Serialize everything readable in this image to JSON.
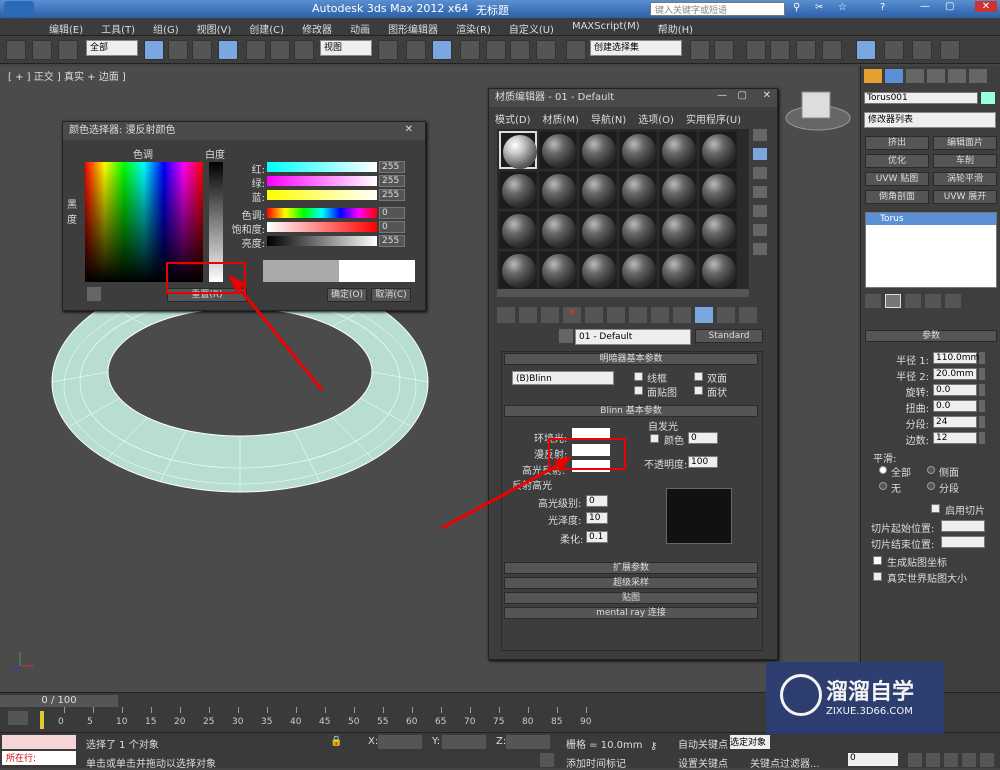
{
  "titlebar": {
    "app_title": "Autodesk 3ds Max  2012 x64",
    "doc_title": "无标题",
    "search_placeholder": "键入关键字或短语"
  },
  "menu": [
    "编辑(E)",
    "工具(T)",
    "组(G)",
    "视图(V)",
    "创建(C)",
    "修改器",
    "动画",
    "图形编辑器",
    "渲染(R)",
    "自定义(U)",
    "MAXScript(M)",
    "帮助(H)"
  ],
  "toolbar": {
    "filter": "全部",
    "view": "视图",
    "selset": "创建选择集"
  },
  "viewport": {
    "label": "[ + ] 正交 ] 真实 + 边面 ]"
  },
  "cmdpanel": {
    "object_name": "Torus001",
    "modifier_list": "修改器列表",
    "buttons": [
      "挤出",
      "编辑面片",
      "优化",
      "车削",
      "UVW 贴图",
      "涡轮平滑",
      "倒角剖面",
      "UVW 展开"
    ],
    "stack_item": "Torus",
    "params_title": "参数",
    "params": [
      {
        "label": "半径 1:",
        "value": "110.0mm"
      },
      {
        "label": "半径 2:",
        "value": "20.0mm"
      },
      {
        "label": "旋转:",
        "value": "0.0"
      },
      {
        "label": "扭曲:",
        "value": "0.0"
      },
      {
        "label": "分段:",
        "value": "24"
      },
      {
        "label": "边数:",
        "value": "12"
      }
    ],
    "smooth_title": "平滑:",
    "smooth_options": [
      "全部",
      "侧面",
      "无",
      "分段"
    ],
    "slice_on": "启用切片",
    "slice_from": "切片起始位置:",
    "slice_to": "切片结束位置:",
    "gen_uv": "生成贴图坐标",
    "real_world": "真实世界贴图大小"
  },
  "color_picker": {
    "title": "颜色选择器: 漫反射颜色",
    "hue_label": "色调",
    "white_label": "白度",
    "black_label": "黑\n度",
    "channels": [
      {
        "label": "红:",
        "value": "255"
      },
      {
        "label": "绿:",
        "value": "255"
      },
      {
        "label": "蓝:",
        "value": "255"
      },
      {
        "label": "色调:",
        "value": "0"
      },
      {
        "label": "饱和度:",
        "value": "0"
      },
      {
        "label": "亮度:",
        "value": "255"
      }
    ],
    "reset": "重置(R)",
    "ok": "确定(O)",
    "cancel": "取消(C)"
  },
  "mat_editor": {
    "title": "材质编辑器 - 01 - Default",
    "menu": [
      "模式(D)",
      "材质(M)",
      "导航(N)",
      "选项(O)",
      "实用程序(U)"
    ],
    "mat_name": "01 - Default",
    "mat_type": "Standard",
    "shader_rollout": "明暗器基本参数",
    "shader": "(B)Blinn",
    "shader_opts": [
      "线框",
      "双面",
      "面贴图",
      "面状"
    ],
    "blinn_rollout": "Blinn 基本参数",
    "self_illum": "自发光",
    "color_label": "颜色",
    "self_illum_val": "0",
    "ambient": "环境光:",
    "diffuse": "漫反射:",
    "specular": "高光反射:",
    "opacity_label": "不透明度:",
    "opacity": "100",
    "spec_group": "反射高光",
    "spec_level_label": "高光级别:",
    "spec_level": "0",
    "gloss_label": "光泽度:",
    "gloss": "10",
    "soften_label": "柔化:",
    "soften": "0.1",
    "rollouts": [
      "扩展参数",
      "超级采样",
      "贴图",
      "mental ray 连接"
    ]
  },
  "timeline": {
    "frame": "0 / 100",
    "ticks": [
      "0",
      "5",
      "10",
      "15",
      "20",
      "25",
      "30",
      "35",
      "40",
      "45",
      "50",
      "55",
      "60",
      "65",
      "70",
      "75",
      "80",
      "85",
      "90"
    ]
  },
  "status": {
    "mode": "所在行:",
    "selected": "选择了 1 个对象",
    "hint": "单击或单击并拖动以选择对象",
    "x": "X:",
    "y": "Y:",
    "z": "Z:",
    "grid": "栅格 = 10.0mm",
    "add_tag": "添加时间标记",
    "auto_key": "自动关键点",
    "set_key": "设置关键点",
    "sel_obj": "选定对象",
    "key_filter": "关键点过滤器...",
    "frame_val": "0"
  },
  "watermark": {
    "brand": "溜溜自学",
    "url": "ZIXUE.3D66.COM"
  }
}
